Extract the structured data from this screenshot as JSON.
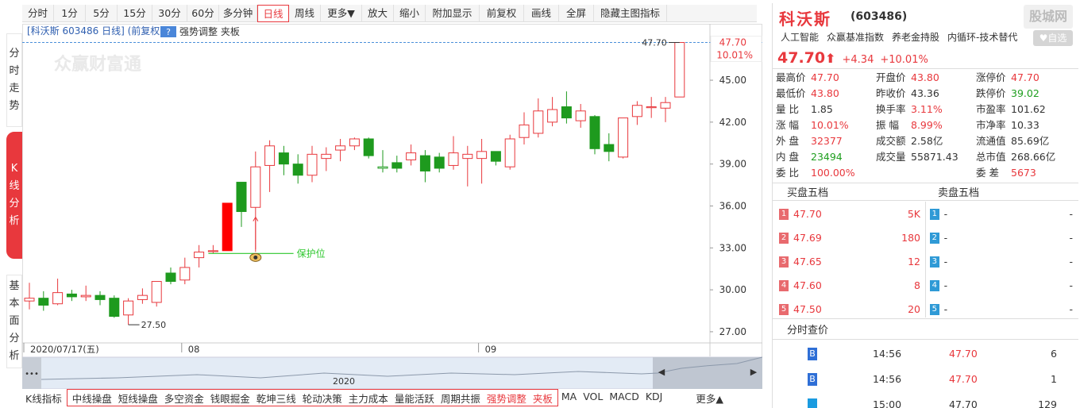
{
  "side_tabs": [
    "分时走势",
    "K线分析",
    "基本面分析"
  ],
  "toolbar": [
    "分时",
    "1分",
    "5分",
    "15分",
    "30分",
    "60分",
    "多分钟",
    "日线",
    "周线",
    "更多▼",
    "放大",
    "缩小",
    "附加显示",
    "前复权",
    "画线",
    "全屏",
    "隐藏主图指标"
  ],
  "toolbar_active": "日线",
  "chart_header": {
    "title": "[科沃斯 603486 日线] (前复权)",
    "help": "?",
    "indicator": "强势调整 夹板"
  },
  "watermark": "众赢财富通",
  "overview_year": "2020",
  "chart_data": {
    "type": "candlestick",
    "yticks": [
      27.0,
      30.0,
      33.0,
      36.0,
      39.0,
      42.0,
      45.0
    ],
    "ylim": [
      26.2,
      47.9
    ],
    "last_price_label": "47.70",
    "last_change_label": "10.01%",
    "high_annotation": "47.70",
    "low_annotation": "27.50",
    "support_label": "保护位",
    "support_level": 32.6,
    "x_labels": [
      {
        "label": "2020/07/17(五)",
        "index": 0
      },
      {
        "label": "08",
        "index": 11
      },
      {
        "label": "09",
        "index": 32
      }
    ],
    "candles": [
      [
        29.2,
        29.4,
        28.6,
        30.5,
        "doji"
      ],
      [
        29.4,
        28.9,
        28.5,
        29.9,
        "dn"
      ],
      [
        29.0,
        29.8,
        28.9,
        30.8,
        "up"
      ],
      [
        29.7,
        29.5,
        29.2,
        30.0,
        "dn"
      ],
      [
        29.5,
        29.6,
        29.2,
        30.3,
        "up"
      ],
      [
        29.6,
        29.3,
        28.9,
        29.9,
        "dn"
      ],
      [
        29.4,
        28.1,
        28.0,
        29.6,
        "dn"
      ],
      [
        28.2,
        29.2,
        27.5,
        29.4,
        "up"
      ],
      [
        29.3,
        29.6,
        29.0,
        30.1,
        "up"
      ],
      [
        29.1,
        30.6,
        28.8,
        30.6,
        "up"
      ],
      [
        31.2,
        30.6,
        30.4,
        31.6,
        "dn"
      ],
      [
        30.7,
        31.6,
        30.4,
        32.3,
        "up"
      ],
      [
        32.3,
        32.7,
        31.6,
        33.2,
        "up"
      ],
      [
        32.8,
        32.8,
        32.6,
        33.2,
        "doji"
      ],
      [
        32.8,
        36.2,
        32.8,
        36.2,
        "limit"
      ],
      [
        37.7,
        35.6,
        34.5,
        37.7,
        "dn"
      ],
      [
        35.9,
        38.8,
        32.9,
        39.9,
        "up"
      ],
      [
        38.9,
        40.3,
        37.0,
        40.7,
        "up"
      ],
      [
        39.8,
        39.0,
        38.2,
        40.3,
        "dn"
      ],
      [
        39.0,
        38.2,
        37.6,
        39.7,
        "dn"
      ],
      [
        38.2,
        39.7,
        37.7,
        40.3,
        "up"
      ],
      [
        39.4,
        39.7,
        38.5,
        40.2,
        "up"
      ],
      [
        40.0,
        40.3,
        39.2,
        40.8,
        "up"
      ],
      [
        40.3,
        40.8,
        40.0,
        40.9,
        "up"
      ],
      [
        40.8,
        39.6,
        39.4,
        40.9,
        "dn"
      ],
      [
        38.8,
        38.7,
        38.4,
        40.0,
        "doji"
      ],
      [
        38.7,
        39.1,
        38.4,
        39.6,
        "dn"
      ],
      [
        39.3,
        39.8,
        38.9,
        40.4,
        "up"
      ],
      [
        39.6,
        38.5,
        37.7,
        40.0,
        "dn"
      ],
      [
        39.5,
        38.7,
        38.4,
        39.8,
        "dn"
      ],
      [
        39.8,
        38.9,
        38.6,
        41.0,
        "up"
      ],
      [
        39.4,
        39.7,
        37.4,
        40.3,
        "up"
      ],
      [
        39.4,
        39.9,
        37.6,
        40.8,
        "up"
      ],
      [
        39.9,
        39.2,
        38.9,
        39.9,
        "dn"
      ],
      [
        38.8,
        40.8,
        38.6,
        41.1,
        "up"
      ],
      [
        40.9,
        41.8,
        40.4,
        42.7,
        "up"
      ],
      [
        41.2,
        42.8,
        40.9,
        43.7,
        "up"
      ],
      [
        42.0,
        42.9,
        41.7,
        43.8,
        "up"
      ],
      [
        43.1,
        42.3,
        41.9,
        44.2,
        "dn"
      ],
      [
        42.1,
        42.8,
        41.6,
        43.3,
        "up"
      ],
      [
        42.4,
        40.1,
        39.7,
        42.5,
        "dn"
      ],
      [
        40.4,
        39.9,
        39.2,
        41.2,
        "dn"
      ],
      [
        39.5,
        42.3,
        39.4,
        42.3,
        "up"
      ],
      [
        42.4,
        43.2,
        41.8,
        43.5,
        "up"
      ],
      [
        43.1,
        43.1,
        42.3,
        43.8,
        "doji"
      ],
      [
        43.0,
        43.4,
        42.0,
        43.8,
        "up"
      ],
      [
        43.8,
        47.7,
        43.8,
        47.7,
        "up"
      ]
    ]
  },
  "indicator_tabs": [
    "中线操盘",
    "短线操盘",
    "多空资金",
    "钱眼掘金",
    "乾坤三线",
    "轮动决策",
    "主力成本",
    "量能活跃",
    "周期共振",
    "强势调整",
    "夹板",
    "MA",
    "VOL",
    "MACD",
    "KDJ",
    "更多▲"
  ],
  "indicator_label": "K线指标",
  "indicator_highlight": [
    "强势调整",
    "夹板"
  ],
  "quote": {
    "name": "科沃斯",
    "code": "(603486)",
    "site_badge": "股城网",
    "tags": [
      "人工智能",
      "众赢基准指数",
      "养老金持股",
      "内循环-技术替代"
    ],
    "add_label": "♥自选",
    "price": "47.70",
    "arrow": "⬆",
    "change": "+4.34",
    "change_pct": "+10.01%",
    "rows": [
      [
        [
          "最高价",
          "47.70",
          "red"
        ],
        [
          "开盘价",
          "43.80",
          "red"
        ],
        [
          "涨停价",
          "47.70",
          "red"
        ]
      ],
      [
        [
          "最低价",
          "43.80",
          "red"
        ],
        [
          "昨收价",
          "43.36",
          "dark"
        ],
        [
          "跌停价",
          "39.02",
          "green"
        ]
      ],
      [
        [
          "量 比",
          "1.85",
          "dark"
        ],
        [
          "换手率",
          "3.11%",
          "red"
        ],
        [
          "市盈率",
          "101.62",
          "dark"
        ]
      ],
      [
        [
          "涨 幅",
          "10.01%",
          "red"
        ],
        [
          "振 幅",
          "8.99%",
          "red"
        ],
        [
          "市净率",
          "10.33",
          "dark"
        ]
      ],
      [
        [
          "外 盘",
          "32377",
          "red"
        ],
        [
          "成交额",
          "2.58亿",
          "dark"
        ],
        [
          "流通值",
          "85.69亿",
          "dark"
        ]
      ],
      [
        [
          "内 盘",
          "23494",
          "green"
        ],
        [
          "成交量",
          "55871.43",
          "dark"
        ],
        [
          "总市值",
          "268.66亿",
          "dark"
        ]
      ],
      [
        [
          "委 比",
          "100.00%",
          "red"
        ],
        [
          "",
          "",
          "dark"
        ],
        [
          "委 差",
          "5673",
          "red"
        ]
      ]
    ],
    "buy_title": "买盘五档",
    "sell_title": "卖盘五档",
    "buy": [
      [
        "1",
        "47.70",
        "5K"
      ],
      [
        "2",
        "47.69",
        "180"
      ],
      [
        "3",
        "47.65",
        "12"
      ],
      [
        "4",
        "47.60",
        "8"
      ],
      [
        "5",
        "47.50",
        "20"
      ]
    ],
    "sell": [
      [
        "1",
        "-",
        "-"
      ],
      [
        "2",
        "-",
        "-"
      ],
      [
        "3",
        "-",
        "-"
      ],
      [
        "4",
        "-",
        "-"
      ],
      [
        "5",
        "-",
        "-"
      ]
    ],
    "ticks_title": "分时查价",
    "ticks": [
      [
        "B",
        "14:56",
        "47.70",
        "6",
        "red"
      ],
      [
        "B",
        "14:56",
        "47.70",
        "1",
        "red"
      ],
      [
        "",
        "15:00",
        "47.70",
        "129",
        "dark"
      ]
    ]
  },
  "colors": {
    "up": "#e8383d",
    "down": "#1e9a1e",
    "support": "#2cc72c"
  }
}
